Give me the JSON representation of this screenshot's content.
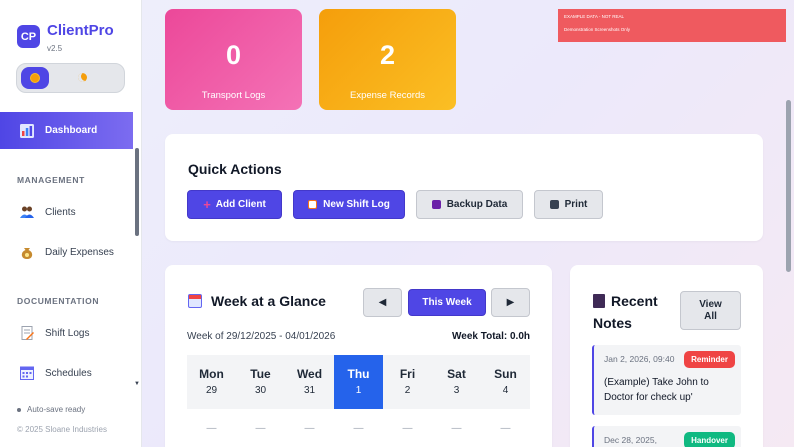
{
  "app": {
    "logo_text": "CP",
    "name": "ClientPro",
    "version": "v2.5"
  },
  "theme": {
    "light_icon": "sun-icon",
    "dark_icon": "moon-icon"
  },
  "sidebar": {
    "active_item": {
      "label": "Dashboard",
      "icon": "chart-icon"
    },
    "sections": [
      {
        "title": "MANAGEMENT",
        "items": [
          {
            "label": "Clients",
            "icon": "people-icon"
          },
          {
            "label": "Daily Expenses",
            "icon": "money-bag-icon"
          }
        ]
      },
      {
        "title": "DOCUMENTATION",
        "items": [
          {
            "label": "Shift Logs",
            "icon": "document-icon"
          },
          {
            "label": "Schedules",
            "icon": "calendar-icon"
          }
        ]
      }
    ],
    "autosave": "Auto-save ready",
    "copyright": "© 2025 Sloane Industries"
  },
  "stats": [
    {
      "value": "0",
      "label": "Transport Logs",
      "color": "#ec4899"
    },
    {
      "value": "2",
      "label": "Expense Records",
      "color": "#f59e0b"
    }
  ],
  "demo_banner": {
    "line1": "EXAMPLE DATA - NOT REAL",
    "line2": "Demonstration Screenshots Only"
  },
  "quick_actions": {
    "title": "Quick Actions",
    "buttons": [
      {
        "label": "Add Client",
        "icon": "plus-icon"
      },
      {
        "label": "New Shift Log",
        "icon": "document-icon"
      },
      {
        "label": "Backup Data",
        "icon": "floppy-disk-icon"
      },
      {
        "label": "Print",
        "icon": "printer-icon"
      }
    ]
  },
  "week": {
    "title": "Week at a Glance",
    "prev": "◀",
    "current_label": "This Week",
    "next": "▶",
    "range": "Week of 29/12/2025 - 04/01/2026",
    "total": "Week Total: 0.0h",
    "days": [
      {
        "name": "Mon",
        "num": "29"
      },
      {
        "name": "Tue",
        "num": "30"
      },
      {
        "name": "Wed",
        "num": "31"
      },
      {
        "name": "Thu",
        "num": "1"
      },
      {
        "name": "Fri",
        "num": "2"
      },
      {
        "name": "Sat",
        "num": "3"
      },
      {
        "name": "Sun",
        "num": "4"
      }
    ],
    "active_day": "Thu",
    "empty_marker": "—"
  },
  "notes": {
    "title_line1": "Recent",
    "title_line2": "Notes",
    "view_all": "View All",
    "items": [
      {
        "date": "Jan 2, 2026, 09:40",
        "tag": "Reminder",
        "tag_color": "#ef4444",
        "text": "(Example) Take John to Doctor for check up'"
      },
      {
        "date": "Dec 28, 2025,",
        "tag": "Handover",
        "tag_color": "#10b981",
        "text": ""
      }
    ]
  }
}
